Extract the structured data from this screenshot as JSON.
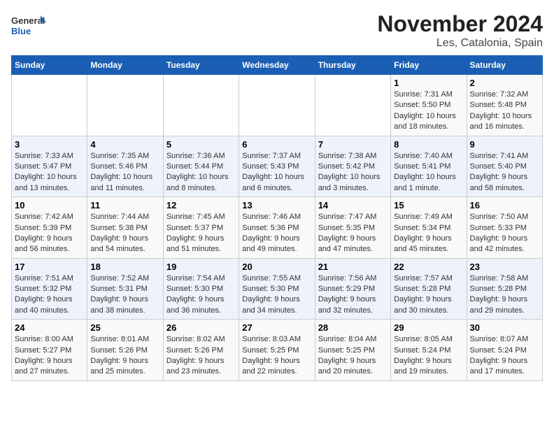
{
  "header": {
    "logo_general": "General",
    "logo_blue": "Blue",
    "title": "November 2024",
    "subtitle": "Les, Catalonia, Spain"
  },
  "days_of_week": [
    "Sunday",
    "Monday",
    "Tuesday",
    "Wednesday",
    "Thursday",
    "Friday",
    "Saturday"
  ],
  "weeks": [
    [
      {
        "day": "",
        "info": ""
      },
      {
        "day": "",
        "info": ""
      },
      {
        "day": "",
        "info": ""
      },
      {
        "day": "",
        "info": ""
      },
      {
        "day": "",
        "info": ""
      },
      {
        "day": "1",
        "info": "Sunrise: 7:31 AM\nSunset: 5:50 PM\nDaylight: 10 hours and 18 minutes."
      },
      {
        "day": "2",
        "info": "Sunrise: 7:32 AM\nSunset: 5:48 PM\nDaylight: 10 hours and 16 minutes."
      }
    ],
    [
      {
        "day": "3",
        "info": "Sunrise: 7:33 AM\nSunset: 5:47 PM\nDaylight: 10 hours and 13 minutes."
      },
      {
        "day": "4",
        "info": "Sunrise: 7:35 AM\nSunset: 5:46 PM\nDaylight: 10 hours and 11 minutes."
      },
      {
        "day": "5",
        "info": "Sunrise: 7:36 AM\nSunset: 5:44 PM\nDaylight: 10 hours and 8 minutes."
      },
      {
        "day": "6",
        "info": "Sunrise: 7:37 AM\nSunset: 5:43 PM\nDaylight: 10 hours and 6 minutes."
      },
      {
        "day": "7",
        "info": "Sunrise: 7:38 AM\nSunset: 5:42 PM\nDaylight: 10 hours and 3 minutes."
      },
      {
        "day": "8",
        "info": "Sunrise: 7:40 AM\nSunset: 5:41 PM\nDaylight: 10 hours and 1 minute."
      },
      {
        "day": "9",
        "info": "Sunrise: 7:41 AM\nSunset: 5:40 PM\nDaylight: 9 hours and 58 minutes."
      }
    ],
    [
      {
        "day": "10",
        "info": "Sunrise: 7:42 AM\nSunset: 5:39 PM\nDaylight: 9 hours and 56 minutes."
      },
      {
        "day": "11",
        "info": "Sunrise: 7:44 AM\nSunset: 5:38 PM\nDaylight: 9 hours and 54 minutes."
      },
      {
        "day": "12",
        "info": "Sunrise: 7:45 AM\nSunset: 5:37 PM\nDaylight: 9 hours and 51 minutes."
      },
      {
        "day": "13",
        "info": "Sunrise: 7:46 AM\nSunset: 5:36 PM\nDaylight: 9 hours and 49 minutes."
      },
      {
        "day": "14",
        "info": "Sunrise: 7:47 AM\nSunset: 5:35 PM\nDaylight: 9 hours and 47 minutes."
      },
      {
        "day": "15",
        "info": "Sunrise: 7:49 AM\nSunset: 5:34 PM\nDaylight: 9 hours and 45 minutes."
      },
      {
        "day": "16",
        "info": "Sunrise: 7:50 AM\nSunset: 5:33 PM\nDaylight: 9 hours and 42 minutes."
      }
    ],
    [
      {
        "day": "17",
        "info": "Sunrise: 7:51 AM\nSunset: 5:32 PM\nDaylight: 9 hours and 40 minutes."
      },
      {
        "day": "18",
        "info": "Sunrise: 7:52 AM\nSunset: 5:31 PM\nDaylight: 9 hours and 38 minutes."
      },
      {
        "day": "19",
        "info": "Sunrise: 7:54 AM\nSunset: 5:30 PM\nDaylight: 9 hours and 36 minutes."
      },
      {
        "day": "20",
        "info": "Sunrise: 7:55 AM\nSunset: 5:30 PM\nDaylight: 9 hours and 34 minutes."
      },
      {
        "day": "21",
        "info": "Sunrise: 7:56 AM\nSunset: 5:29 PM\nDaylight: 9 hours and 32 minutes."
      },
      {
        "day": "22",
        "info": "Sunrise: 7:57 AM\nSunset: 5:28 PM\nDaylight: 9 hours and 30 minutes."
      },
      {
        "day": "23",
        "info": "Sunrise: 7:58 AM\nSunset: 5:28 PM\nDaylight: 9 hours and 29 minutes."
      }
    ],
    [
      {
        "day": "24",
        "info": "Sunrise: 8:00 AM\nSunset: 5:27 PM\nDaylight: 9 hours and 27 minutes."
      },
      {
        "day": "25",
        "info": "Sunrise: 8:01 AM\nSunset: 5:26 PM\nDaylight: 9 hours and 25 minutes."
      },
      {
        "day": "26",
        "info": "Sunrise: 8:02 AM\nSunset: 5:26 PM\nDaylight: 9 hours and 23 minutes."
      },
      {
        "day": "27",
        "info": "Sunrise: 8:03 AM\nSunset: 5:25 PM\nDaylight: 9 hours and 22 minutes."
      },
      {
        "day": "28",
        "info": "Sunrise: 8:04 AM\nSunset: 5:25 PM\nDaylight: 9 hours and 20 minutes."
      },
      {
        "day": "29",
        "info": "Sunrise: 8:05 AM\nSunset: 5:24 PM\nDaylight: 9 hours and 19 minutes."
      },
      {
        "day": "30",
        "info": "Sunrise: 8:07 AM\nSunset: 5:24 PM\nDaylight: 9 hours and 17 minutes."
      }
    ]
  ]
}
